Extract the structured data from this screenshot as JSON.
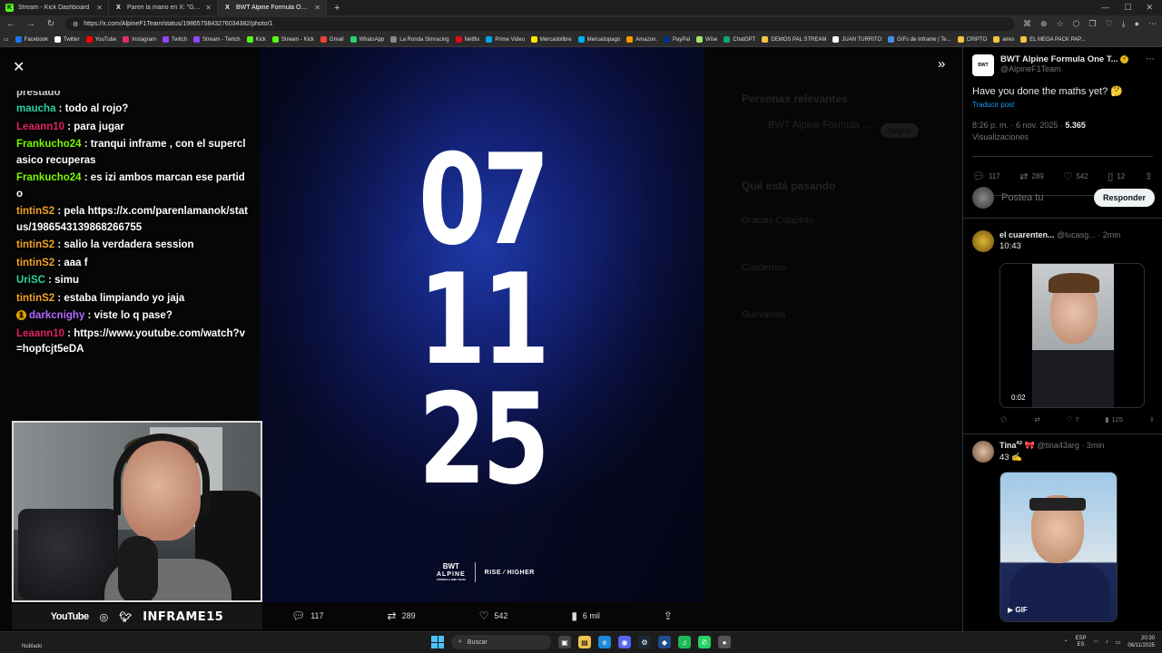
{
  "browser": {
    "tabs": [
      {
        "title": "Stream - Kick Dashboard",
        "icon": "K",
        "color": "#53fc18"
      },
      {
        "title": "Paren la mano en X: \"GERCHO SE",
        "icon": "X",
        "color": "#ffffff"
      },
      {
        "title": "BWT Alpine Formula One Team en",
        "icon": "X",
        "color": "#ffffff"
      }
    ],
    "url": "https://x.com/AlpineF1Team/status/1986575843276034382/photo/1",
    "bookmarks": [
      {
        "label": "Facebook",
        "color": "#1877f2"
      },
      {
        "label": "Twitter",
        "color": "#ffffff"
      },
      {
        "label": "YouTube",
        "color": "#ff0000"
      },
      {
        "label": "Instagram",
        "color": "#e1306c"
      },
      {
        "label": "Twitch",
        "color": "#9146ff"
      },
      {
        "label": "Stream - Twitch",
        "color": "#9146ff"
      },
      {
        "label": "Kick",
        "color": "#53fc18"
      },
      {
        "label": "Stream - Kick",
        "color": "#53fc18"
      },
      {
        "label": "Gmail",
        "color": "#ea4335"
      },
      {
        "label": "WhatsApp",
        "color": "#25d366"
      },
      {
        "label": "La Ronda Simracing",
        "color": "#888888"
      },
      {
        "label": "Netflix",
        "color": "#e50914"
      },
      {
        "label": "Prime Video",
        "color": "#00a8e1"
      },
      {
        "label": "Mercadolibre",
        "color": "#ffe600"
      },
      {
        "label": "Mercadopago",
        "color": "#00b1ea"
      },
      {
        "label": "Amazon.",
        "color": "#ff9900"
      },
      {
        "label": "PayPal",
        "color": "#003087"
      },
      {
        "label": "Wise",
        "color": "#9fe870"
      },
      {
        "label": "ChatGPT",
        "color": "#10a37f"
      },
      {
        "label": "DEMOS PAL STREAM",
        "color": "#f4c542"
      },
      {
        "label": "JUAN TURRITO",
        "color": "#ffffff"
      },
      {
        "label": "GIFs de Inframe | Te...",
        "color": "#4a90e2"
      },
      {
        "label": "CRIPTO",
        "color": "#f4c542"
      },
      {
        "label": "aires",
        "color": "#f4c542"
      },
      {
        "label": "EL MEGA PACK PAP...",
        "color": "#f4c542"
      }
    ]
  },
  "chat": {
    "partial_top": "prestado",
    "messages": [
      {
        "user": "maucha",
        "color": "#2bd4a4",
        "text": " : todo al rojo?",
        "badge": ""
      },
      {
        "user": "Leaann10",
        "color": "#e0245e",
        "text": " : para jugar",
        "badge": ""
      },
      {
        "user": "Frankucho24",
        "color": "#7cfc00",
        "text": " : tranqui inframe , con el superclasico recuperas",
        "badge": ""
      },
      {
        "user": "Frankucho24",
        "color": "#7cfc00",
        "text": " : es izi ambos marcan ese partido",
        "badge": ""
      },
      {
        "user": "tintinS2",
        "color": "#f4a32b",
        "text": " : pela https://x.com/parenlamanok/status/1986543139868266755",
        "badge": ""
      },
      {
        "user": "tintinS2",
        "color": "#f4a32b",
        "text": " : salio la verdadera session",
        "badge": ""
      },
      {
        "user": "tintinS2",
        "color": "#f4a32b",
        "text": " : aaa f",
        "badge": ""
      },
      {
        "user": "UriSC",
        "color": "#2bd4a4",
        "text": " : simu",
        "badge": ""
      },
      {
        "user": "tintinS2",
        "color": "#f4a32b",
        "text": " : estaba limpiando yo jaja",
        "badge": ""
      },
      {
        "user": "darkcnighy",
        "color": "#b36bff",
        "text": " : viste lo q pase?",
        "badge": "1"
      },
      {
        "user": "Leaann10",
        "color": "#e0245e",
        "text": " : https://www.youtube.com/watch?v=hopfcjt5eDA",
        "badge": ""
      }
    ]
  },
  "stream_overlay": {
    "youtube": "YouTube",
    "handle": "INFRAME15"
  },
  "photo": {
    "line1": "07",
    "line2": "11",
    "line3": "25",
    "brand_top": "BWT",
    "brand_mid": "ALPINE",
    "brand_bottom": "FORMULA ONE TEAM",
    "slogan_a": "RISE",
    "slogan_b": "HIGHER"
  },
  "viewer_actions": {
    "replies": "117",
    "retweets": "289",
    "likes": "542",
    "views": "6 mil"
  },
  "background_sidebar": {
    "title1": "Personas relevantes",
    "item1": "BWT Alpine Formula ...",
    "follow": "Seguir",
    "title2": "Qué está pasando",
    "t1": "Gracias Colapinto",
    "t2": "Cuadernos",
    "t3": "Guevarista"
  },
  "panel": {
    "account_name": "BWT Alpine Formula One T...",
    "account_handle": "@AlpineF1Team",
    "tweet_text": "Have you done the maths yet? 🤔",
    "translate": "Traducir post",
    "time": "8:26 p. m. · 6 nov. 2025 · ",
    "views_count": "5.365",
    "views_label": "Visualizaciones",
    "stats": {
      "replies": "117",
      "retweets": "289",
      "likes": "542",
      "bookmarks": "12"
    },
    "reply_placeholder": "Postea tu",
    "reply_button": "Responder",
    "replies": [
      {
        "name": "el cuarenten...",
        "handle": "@lucasg...",
        "time": "· 2min",
        "text": "10:43",
        "video_time": "0:02",
        "stats": [
          "",
          "",
          "7",
          "125"
        ]
      },
      {
        "name": "Tina",
        "sup": "43",
        "handle": "@tina43arg",
        "time": "· 3min",
        "text": "43 ✍️",
        "gif": "GIF"
      }
    ]
  },
  "taskbar": {
    "weather": "Nublado",
    "search": "Buscar",
    "lang1": "ESP",
    "lang2": "ES",
    "time": "20:30",
    "date": "06/11/2025"
  }
}
